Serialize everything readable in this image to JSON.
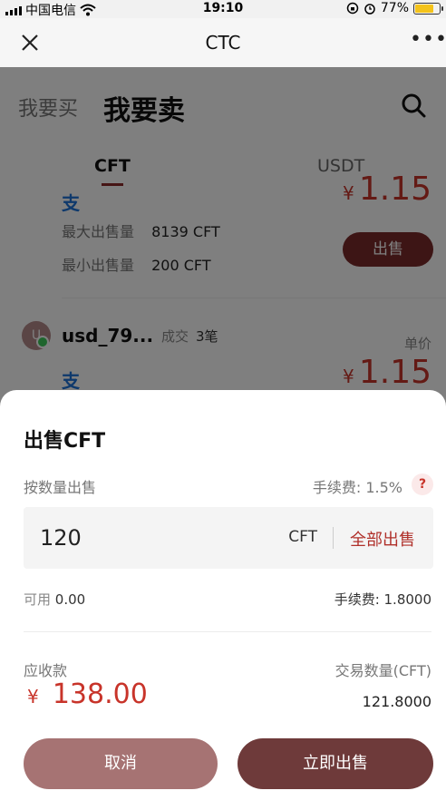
{
  "status_bar": {
    "carrier": "中国电信",
    "time": "19:10",
    "battery": "77%",
    "battery_level": 0.77
  },
  "nav": {
    "title": "CTC",
    "more": "•••"
  },
  "page": {
    "tab_buy": "我要买",
    "tab_sell": "我要卖",
    "subtabs": [
      "CFT",
      "USDT"
    ],
    "listing1": {
      "max_label": "最大出售量",
      "max_value": "8139 CFT",
      "min_label": "最小出售量",
      "min_value": "200 CFT",
      "sell_button": "出售",
      "price_yen": "¥",
      "price": "1.15"
    },
    "listing2": {
      "avatar_initial": "U",
      "user": "usd_79...",
      "deal_label": "成交",
      "deal_count": "3笔",
      "unit_price_label": "单价",
      "pay_icon": "支",
      "price_yen": "¥",
      "price": "1.15"
    }
  },
  "sheet": {
    "title": "出售CFT",
    "mode_label": "按数量出售",
    "fee_rate": "手续费: 1.5%",
    "help": "?",
    "amount_value": "120",
    "unit": "CFT",
    "sell_all": "全部出售",
    "available_label": "可用",
    "available_value": "0.00",
    "fee_amount": "手续费: 1.8000",
    "receivable_label": "应收款",
    "receivable_yen": "¥",
    "receivable_value": "138.00",
    "trade_qty_label": "交易数量(CFT)",
    "trade_qty_value": "121.8000",
    "cancel": "取消",
    "confirm": "立即出售"
  },
  "colors": {
    "accent_red": "#c8342a",
    "button_dark": "#6e3a3a",
    "button_light": "#a67373",
    "battery": "#f4c31b"
  }
}
